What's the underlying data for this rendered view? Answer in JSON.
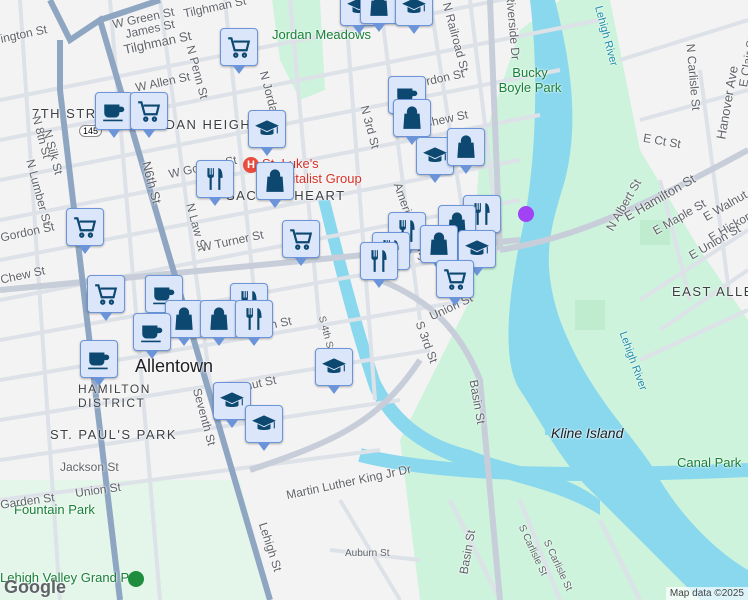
{
  "districts": [
    "7TH STR",
    "JORDAN HEIGHTS",
    "SACRED HEART",
    "ALLENTOWN",
    "EAST ALLEN",
    "ST. PAUL'S PARK",
    "HAMILTON DISTRICT"
  ],
  "city": "Allentown",
  "parks": [
    "Jordan Meadows",
    "Bucky Boyle Park",
    "Kline Island",
    "Canal Park",
    "Fountain Park"
  ],
  "poi": {
    "hospital": "St. Luke's Hospitalist Group",
    "grandprix": "Lehigh Valley Grand Prix"
  },
  "rivers": [
    "Lehigh River",
    "Lehigh River"
  ],
  "route": "145",
  "streets": [
    "Tilghman St",
    "Tilghman St",
    "W Green St",
    "James St",
    "ington St",
    "N Penn St",
    "W Allen St",
    "N Jordan St",
    "N Silk St",
    "N 8th St",
    "N Lumber St",
    "N6th St",
    "W Gordon St",
    "N Law St",
    "Gordon St",
    "W Turner St",
    "Chew St",
    "S 4th St",
    "Hamilton St",
    "Walnut St",
    "Seventh St",
    "Lehigh St",
    "Jackson St",
    "Union St",
    "Garden St",
    "Martin Luther King Jr Dr",
    "Auburn St",
    "Basin St",
    "Basin St",
    "S 3rd St",
    "Union St",
    "N 3rd St",
    "N Railroad St",
    "Riverside Dr",
    "Gordon St",
    "Chew St",
    "N Carlisle St",
    "Hanover Ave",
    "E Clair St",
    "E Ct St",
    "N Albert St",
    "E Hamilton St",
    "E Maple St",
    "E Walnut St",
    "E Hickory St",
    "E Union St",
    "S Carlisle St",
    "S Carlisle St",
    "American Pkwy"
  ],
  "markers": [
    "school",
    "bag",
    "school",
    "cart",
    "coffee",
    "cart",
    "school",
    "coffee",
    "bag",
    "school",
    "bag",
    "food",
    "bag",
    "cart",
    "cart",
    "food",
    "food",
    "food",
    "bag",
    "food",
    "bag",
    "school",
    "cart",
    "cart",
    "coffee",
    "bag",
    "food",
    "bag",
    "food",
    "coffee",
    "coffee",
    "school",
    "school",
    "school"
  ],
  "attribution": "Map data ©2025",
  "logo": "Google",
  "colors": {
    "water": "#8ad8ee",
    "park": "#cdf3dc",
    "major": "#8fa6c2",
    "marker": "#dbe6fb",
    "icon": "#0d4870"
  }
}
